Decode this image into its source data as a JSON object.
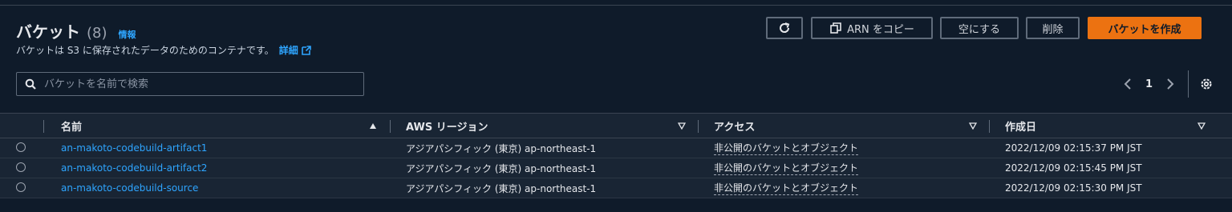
{
  "header": {
    "title": "バケット",
    "count": "(8)",
    "info": "情報",
    "description": "バケットは S3 に保存されたデータのためのコンテナです。",
    "details_link": "詳細"
  },
  "toolbar": {
    "refresh_icon": "refresh-icon",
    "copy_arn_label": "ARN をコピー",
    "empty_label": "空にする",
    "delete_label": "削除",
    "create_label": "バケットを作成"
  },
  "search": {
    "placeholder": "バケットを名前で検索"
  },
  "pagination": {
    "current_page": "1"
  },
  "table": {
    "columns": [
      "名前",
      "AWS リージョン",
      "アクセス",
      "作成日"
    ],
    "rows": [
      {
        "name": "an-makoto-codebuild-artifact1",
        "region": "アジアパシフィック (東京) ap-northeast-1",
        "access": "非公開のバケットとオブジェクト",
        "created": "2022/12/09 02:15:37 PM JST"
      },
      {
        "name": "an-makoto-codebuild-artifact2",
        "region": "アジアパシフィック (東京) ap-northeast-1",
        "access": "非公開のバケットとオブジェクト",
        "created": "2022/12/09 02:15:45 PM JST"
      },
      {
        "name": "an-makoto-codebuild-source",
        "region": "アジアパシフィック (東京) ap-northeast-1",
        "access": "非公開のバケットとオブジェクト",
        "created": "2022/12/09 02:15:30 PM JST"
      }
    ]
  },
  "colors": {
    "background": "#0f1b2a",
    "row_background": "#192534",
    "link": "#2ea5ff",
    "primary": "#ec7211"
  }
}
